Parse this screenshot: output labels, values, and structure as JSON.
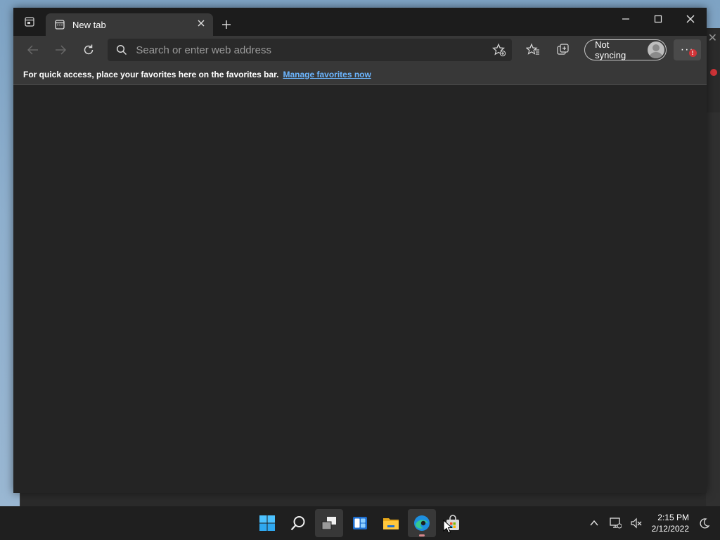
{
  "browser": {
    "tab": {
      "label": "New tab"
    },
    "address": {
      "placeholder": "Search or enter web address"
    },
    "profile": {
      "label": "Not syncing"
    },
    "more_badge": "!",
    "favorites_bar": {
      "message": "For quick access, place your favorites here on the favorites bar.",
      "link": "Manage favorites now"
    }
  },
  "taskbar": {
    "clock": {
      "time": "2:15 PM",
      "date": "2/12/2022"
    }
  },
  "colors": {
    "accent_link": "#6cb6ff",
    "badge": "#d13438",
    "tab_bg": "#383838",
    "titlebar_bg": "#1c1c1c",
    "content_bg": "#242424"
  },
  "icons": [
    "tab-actions-icon",
    "page-icon",
    "close-icon",
    "plus-icon",
    "minimize-icon",
    "maximize-icon",
    "back-arrow-icon",
    "forward-arrow-icon",
    "refresh-icon",
    "search-icon",
    "add-favorite-icon",
    "favorites-icon",
    "collections-icon",
    "more-icon",
    "windows-logo-icon",
    "search-taskbar-icon",
    "task-view-icon",
    "widgets-icon",
    "file-explorer-icon",
    "edge-icon",
    "store-icon",
    "chevron-up-icon",
    "network-icon",
    "volume-muted-icon",
    "moon-icon"
  ]
}
